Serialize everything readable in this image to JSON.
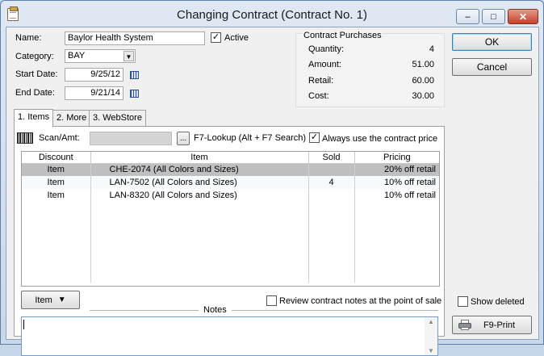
{
  "window": {
    "title": "Changing Contract  (Contract No. 1)",
    "buttons": {
      "minimize": "–",
      "maximize": "□",
      "close": "✕"
    }
  },
  "form": {
    "name_label": "Name:",
    "name_value": "Baylor Health System",
    "active_label": "Active",
    "active_checked": true,
    "category_label": "Category:",
    "category_value": "BAY",
    "start_label": "Start Date:",
    "start_value": "9/25/12",
    "end_label": "End Date:",
    "end_value": "9/21/14"
  },
  "purchases": {
    "title": "Contract Purchases",
    "rows": [
      {
        "label": "Quantity:",
        "value": "4"
      },
      {
        "label": "Amount:",
        "value": "51.00"
      },
      {
        "label": "Retail:",
        "value": "60.00"
      },
      {
        "label": "Cost:",
        "value": "30.00"
      }
    ]
  },
  "actions": {
    "ok": "OK",
    "cancel": "Cancel",
    "print": "F9-Print"
  },
  "tabs": [
    {
      "label": "1. Items"
    },
    {
      "label": "2. More"
    },
    {
      "label": "3. WebStore"
    }
  ],
  "items_tab": {
    "scan_label": "Scan/Amt:",
    "scan_value": "",
    "lookup_button": "...",
    "lookup_label": "F7-Lookup  (Alt + F7 Search)",
    "always_use_label": "Always use the contract price",
    "always_use_checked": true,
    "columns": [
      "Discount",
      "Item",
      "Sold",
      "Pricing"
    ],
    "rows": [
      {
        "discount": "Item",
        "item": "CHE-2074  (All Colors and Sizes)",
        "sold": "",
        "pricing": "20% off retail"
      },
      {
        "discount": "Item",
        "item": "LAN-7502  (All Colors and Sizes)",
        "sold": "4",
        "pricing": "10% off retail"
      },
      {
        "discount": "Item",
        "item": "LAN-8320  (All Colors and Sizes)",
        "sold": "",
        "pricing": "10% off retail"
      }
    ],
    "item_button": "Item",
    "review_label": "Review contract notes at the point of sale",
    "review_checked": false,
    "notes_label": "Notes",
    "notes_value": ""
  },
  "show_deleted_label": "Show deleted",
  "show_deleted_checked": false
}
